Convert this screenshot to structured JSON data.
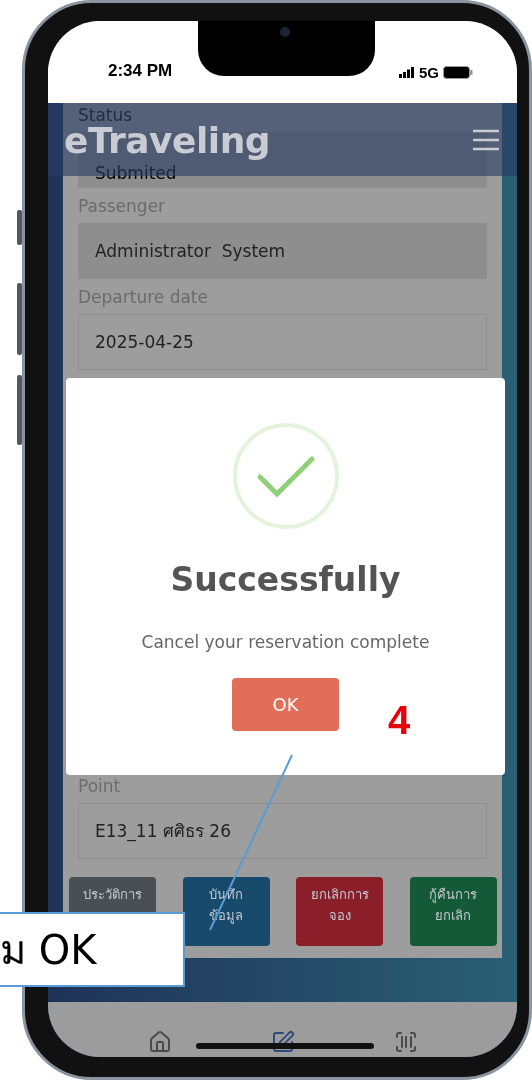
{
  "status_bar": {
    "time": "2:34 PM",
    "network": "5G"
  },
  "header": {
    "title": "eTraveling"
  },
  "fields_top": [
    {
      "label": "Status",
      "value": "Submited",
      "readonly": true
    },
    {
      "label": "Passenger",
      "value": "Administrator  System",
      "readonly": true
    },
    {
      "label": "Departure date",
      "value": "2025-04-25",
      "readonly": false
    }
  ],
  "fields_bottom": [
    {
      "label": "Point",
      "value": "E13_11 ศศิธร 26",
      "readonly": false
    }
  ],
  "actions": [
    {
      "label": "ประวัติการ",
      "color": "#4a4f55"
    },
    {
      "label": "บันทึก\nข้อมูล",
      "color": "#184a6c"
    },
    {
      "label": "ยกเลิกการ\nจอง",
      "color": "#8a1f2a"
    },
    {
      "label": "กู้คืนการ\nยกเลิก",
      "color": "#155a38"
    }
  ],
  "dialog": {
    "title": "Successfully",
    "message": "Cancel your reservation complete",
    "button": "OK"
  },
  "annotation": {
    "step": "4",
    "callout": "ม OK"
  }
}
